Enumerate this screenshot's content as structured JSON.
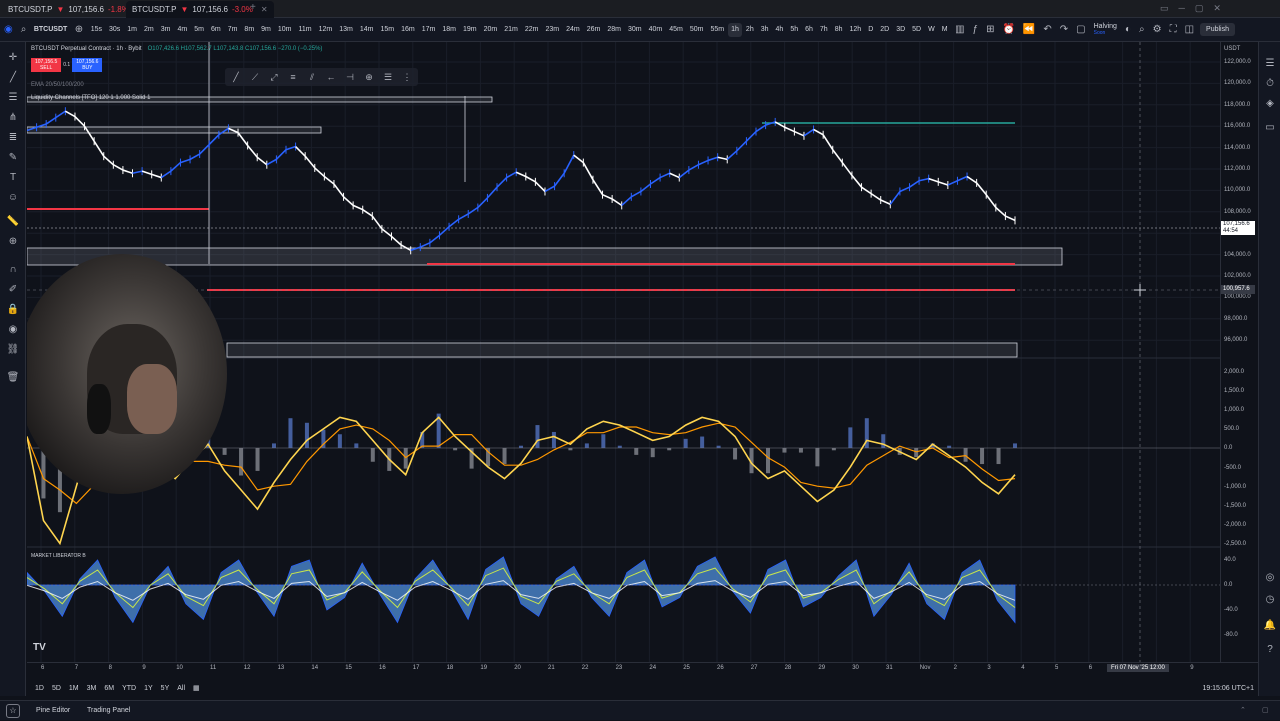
{
  "tabs": [
    {
      "symbol": "BTCUSDT.P",
      "price": "107,156.6",
      "change": "-1.8%"
    },
    {
      "symbol": "BTCUSDT.P",
      "price": "107,156.6",
      "change": "-3.0%"
    }
  ],
  "toolbar": {
    "symbol": "BTCUSDT",
    "timeframes": [
      "15s",
      "30s",
      "1m",
      "2m",
      "3m",
      "4m",
      "5m",
      "6m",
      "7m",
      "8m",
      "9m",
      "10m",
      "11m",
      "12m",
      "13m",
      "14m",
      "15m",
      "16m",
      "17m",
      "18m",
      "19m",
      "20m",
      "21m",
      "22m",
      "23m",
      "24m",
      "26m",
      "28m",
      "30m",
      "40m",
      "45m",
      "50m",
      "55m",
      "1h",
      "2h",
      "3h",
      "4h",
      "5h",
      "6h",
      "7h",
      "8h",
      "12h",
      "D",
      "2D",
      "3D",
      "5D",
      "W",
      "M"
    ],
    "selected_timeframe": "1h",
    "halving_label": "Halving",
    "halving_sub": "Soon",
    "publish_label": "Publish"
  },
  "legend": {
    "title": "BTCUSDT Perpetual Contract · 1h · Bybit",
    "ohlc": "O107,426.6 H107,562.7 L107,143.8 C107,156.6 −270.0 (−0.25%)",
    "sell_price": "107,156.5",
    "sell_label": "SELL",
    "spread": "0.1",
    "buy_price": "107,156.6",
    "buy_label": "BUY",
    "ema": "EMA 20/50/100/200",
    "liquidity": "Liquidity Channels [TFO] 120 1 1.000 Solid 1",
    "market": "MARKET LIBERATOR B"
  },
  "price_axis": {
    "currency": "USDT",
    "labels": [
      "122,000.0",
      "120,000.0",
      "118,000.0",
      "116,000.0",
      "114,000.0",
      "112,000.0",
      "110,000.0",
      "108,000.0",
      "106,000.0",
      "104,000.0",
      "102,000.0",
      "100,000.0",
      "98,000.0",
      "96,000.0"
    ],
    "current_price": "107,156.6",
    "countdown": "44:54",
    "crosshair_price": "100,957.6",
    "macd_labels": [
      "2,000.0",
      "1,500.0",
      "1,000.0",
      "500.0",
      "0.0",
      "-500.0",
      "-1,000.0",
      "-1,500.0",
      "-2,000.0",
      "-2,500.0"
    ],
    "osc_labels": [
      "40.0",
      "0.0",
      "-40.0",
      "-80.0"
    ]
  },
  "time_axis": {
    "labels": [
      "6",
      "7",
      "8",
      "9",
      "10",
      "11",
      "12",
      "13",
      "14",
      "15",
      "16",
      "17",
      "18",
      "19",
      "20",
      "21",
      "22",
      "23",
      "24",
      "25",
      "26",
      "27",
      "28",
      "29",
      "30",
      "31",
      "Nov",
      "2",
      "3",
      "4",
      "5",
      "6",
      "7",
      "8",
      "9"
    ],
    "crosshair_time": "Fri 07 Nov '25   12:00"
  },
  "range": {
    "buttons": [
      "1D",
      "5D",
      "1M",
      "3M",
      "6M",
      "YTD",
      "1Y",
      "5Y",
      "All"
    ],
    "clock": "19:15:06 UTC+1"
  },
  "bottom": {
    "pine_editor": "Pine Editor",
    "trading_panel": "Trading Panel"
  },
  "colors": {
    "up": "#2962ff",
    "down": "#ffffff",
    "macd": "#ffd54f",
    "signal": "#ff9800",
    "red_line": "#f23645",
    "green_line": "#26a69a",
    "osc_fill": "#4f8fdb"
  },
  "price_series": [
    115600,
    115900,
    116200,
    116800,
    117400,
    116900,
    116000,
    114600,
    113200,
    112400,
    111900,
    111600,
    111800,
    111500,
    111200,
    111800,
    112600,
    112900,
    113400,
    114300,
    115200,
    115800,
    115400,
    114200,
    113100,
    112400,
    112900,
    113800,
    114100,
    113200,
    112100,
    111300,
    110600,
    109400,
    108600,
    108200,
    107600,
    106400,
    105700,
    104900,
    104400,
    104700,
    105100,
    105800,
    106600,
    107300,
    107800,
    108400,
    109300,
    110300,
    111200,
    111700,
    111300,
    110800,
    109900,
    110400,
    111600,
    113300,
    112600,
    111000,
    109600,
    109200,
    108600,
    109400,
    109900,
    110600,
    111200,
    111600,
    111200,
    111900,
    112400,
    112800,
    113100,
    112900,
    113700,
    114600,
    115500,
    116100,
    116400,
    115900,
    115500,
    115100,
    115700,
    115200,
    113800,
    112600,
    111400,
    110300,
    109700,
    109100,
    108700,
    109900,
    110300,
    110900,
    111100,
    110800,
    110500,
    110900,
    111300,
    110700,
    109600,
    108400,
    107600,
    107200
  ],
  "macd_series": [
    300,
    -1900,
    -2500,
    -1000,
    500,
    900,
    600,
    200,
    -400,
    -800,
    -300,
    100,
    -600,
    -1100,
    -1600,
    -900,
    -300,
    200,
    500,
    800,
    700,
    200,
    -300,
    -700,
    400,
    800,
    300,
    -100,
    -500,
    -800,
    -400,
    200,
    300,
    100,
    500,
    700,
    600,
    400,
    200,
    300,
    600,
    800,
    700,
    300,
    -400,
    -800,
    -600,
    -1000,
    -1400,
    -1100,
    -500,
    200,
    100,
    -100,
    -300,
    100,
    -200,
    -500,
    -900,
    -1200,
    -700
  ],
  "osc_series": [
    20,
    -10,
    -50,
    10,
    40,
    -20,
    -60,
    0,
    30,
    -30,
    -55,
    20,
    40,
    -10,
    -50,
    30,
    40,
    -40,
    -20,
    35,
    -15,
    -60,
    10,
    40,
    -5,
    -55,
    25,
    45,
    -30,
    -50,
    10,
    30,
    -20,
    -50,
    20,
    40,
    -35,
    -20,
    30,
    45,
    -10,
    -45,
    25,
    40,
    -35,
    -20,
    15,
    40,
    -50,
    -15,
    35,
    -30,
    -55,
    20,
    40,
    -25,
    -60
  ]
}
